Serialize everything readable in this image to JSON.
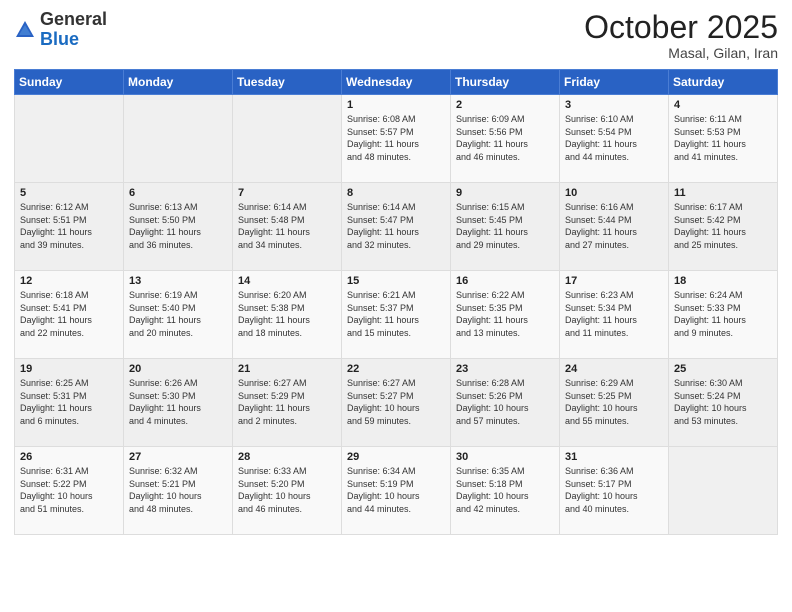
{
  "header": {
    "logo_line1": "General",
    "logo_line2": "Blue",
    "month": "October 2025",
    "location": "Masal, Gilan, Iran"
  },
  "weekdays": [
    "Sunday",
    "Monday",
    "Tuesday",
    "Wednesday",
    "Thursday",
    "Friday",
    "Saturday"
  ],
  "weeks": [
    [
      {
        "day": "",
        "info": ""
      },
      {
        "day": "",
        "info": ""
      },
      {
        "day": "",
        "info": ""
      },
      {
        "day": "1",
        "info": "Sunrise: 6:08 AM\nSunset: 5:57 PM\nDaylight: 11 hours\nand 48 minutes."
      },
      {
        "day": "2",
        "info": "Sunrise: 6:09 AM\nSunset: 5:56 PM\nDaylight: 11 hours\nand 46 minutes."
      },
      {
        "day": "3",
        "info": "Sunrise: 6:10 AM\nSunset: 5:54 PM\nDaylight: 11 hours\nand 44 minutes."
      },
      {
        "day": "4",
        "info": "Sunrise: 6:11 AM\nSunset: 5:53 PM\nDaylight: 11 hours\nand 41 minutes."
      }
    ],
    [
      {
        "day": "5",
        "info": "Sunrise: 6:12 AM\nSunset: 5:51 PM\nDaylight: 11 hours\nand 39 minutes."
      },
      {
        "day": "6",
        "info": "Sunrise: 6:13 AM\nSunset: 5:50 PM\nDaylight: 11 hours\nand 36 minutes."
      },
      {
        "day": "7",
        "info": "Sunrise: 6:14 AM\nSunset: 5:48 PM\nDaylight: 11 hours\nand 34 minutes."
      },
      {
        "day": "8",
        "info": "Sunrise: 6:14 AM\nSunset: 5:47 PM\nDaylight: 11 hours\nand 32 minutes."
      },
      {
        "day": "9",
        "info": "Sunrise: 6:15 AM\nSunset: 5:45 PM\nDaylight: 11 hours\nand 29 minutes."
      },
      {
        "day": "10",
        "info": "Sunrise: 6:16 AM\nSunset: 5:44 PM\nDaylight: 11 hours\nand 27 minutes."
      },
      {
        "day": "11",
        "info": "Sunrise: 6:17 AM\nSunset: 5:42 PM\nDaylight: 11 hours\nand 25 minutes."
      }
    ],
    [
      {
        "day": "12",
        "info": "Sunrise: 6:18 AM\nSunset: 5:41 PM\nDaylight: 11 hours\nand 22 minutes."
      },
      {
        "day": "13",
        "info": "Sunrise: 6:19 AM\nSunset: 5:40 PM\nDaylight: 11 hours\nand 20 minutes."
      },
      {
        "day": "14",
        "info": "Sunrise: 6:20 AM\nSunset: 5:38 PM\nDaylight: 11 hours\nand 18 minutes."
      },
      {
        "day": "15",
        "info": "Sunrise: 6:21 AM\nSunset: 5:37 PM\nDaylight: 11 hours\nand 15 minutes."
      },
      {
        "day": "16",
        "info": "Sunrise: 6:22 AM\nSunset: 5:35 PM\nDaylight: 11 hours\nand 13 minutes."
      },
      {
        "day": "17",
        "info": "Sunrise: 6:23 AM\nSunset: 5:34 PM\nDaylight: 11 hours\nand 11 minutes."
      },
      {
        "day": "18",
        "info": "Sunrise: 6:24 AM\nSunset: 5:33 PM\nDaylight: 11 hours\nand 9 minutes."
      }
    ],
    [
      {
        "day": "19",
        "info": "Sunrise: 6:25 AM\nSunset: 5:31 PM\nDaylight: 11 hours\nand 6 minutes."
      },
      {
        "day": "20",
        "info": "Sunrise: 6:26 AM\nSunset: 5:30 PM\nDaylight: 11 hours\nand 4 minutes."
      },
      {
        "day": "21",
        "info": "Sunrise: 6:27 AM\nSunset: 5:29 PM\nDaylight: 11 hours\nand 2 minutes."
      },
      {
        "day": "22",
        "info": "Sunrise: 6:27 AM\nSunset: 5:27 PM\nDaylight: 10 hours\nand 59 minutes."
      },
      {
        "day": "23",
        "info": "Sunrise: 6:28 AM\nSunset: 5:26 PM\nDaylight: 10 hours\nand 57 minutes."
      },
      {
        "day": "24",
        "info": "Sunrise: 6:29 AM\nSunset: 5:25 PM\nDaylight: 10 hours\nand 55 minutes."
      },
      {
        "day": "25",
        "info": "Sunrise: 6:30 AM\nSunset: 5:24 PM\nDaylight: 10 hours\nand 53 minutes."
      }
    ],
    [
      {
        "day": "26",
        "info": "Sunrise: 6:31 AM\nSunset: 5:22 PM\nDaylight: 10 hours\nand 51 minutes."
      },
      {
        "day": "27",
        "info": "Sunrise: 6:32 AM\nSunset: 5:21 PM\nDaylight: 10 hours\nand 48 minutes."
      },
      {
        "day": "28",
        "info": "Sunrise: 6:33 AM\nSunset: 5:20 PM\nDaylight: 10 hours\nand 46 minutes."
      },
      {
        "day": "29",
        "info": "Sunrise: 6:34 AM\nSunset: 5:19 PM\nDaylight: 10 hours\nand 44 minutes."
      },
      {
        "day": "30",
        "info": "Sunrise: 6:35 AM\nSunset: 5:18 PM\nDaylight: 10 hours\nand 42 minutes."
      },
      {
        "day": "31",
        "info": "Sunrise: 6:36 AM\nSunset: 5:17 PM\nDaylight: 10 hours\nand 40 minutes."
      },
      {
        "day": "",
        "info": ""
      }
    ]
  ]
}
